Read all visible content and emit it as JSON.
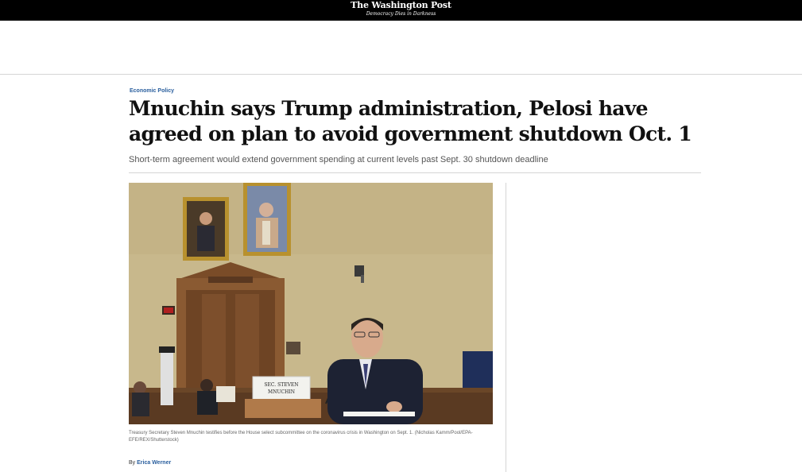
{
  "masthead": {
    "title": "The Washington Post",
    "tagline": "Democracy Dies in Darkness"
  },
  "article": {
    "section": "Economic Policy",
    "headline": "Mnuchin says Trump administration, Pelosi have agreed on plan to avoid government shutdown Oct. 1",
    "subheadline": "Short-term agreement would extend government spending at current levels past Sept. 30 shutdown deadline",
    "photo": {
      "nameplate_line1": "SEC. STEVEN",
      "nameplate_line2": "MNUCHIN"
    },
    "caption": "Treasury Secretary Steven Mnuchin testifies before the House select subcommittee on the coronavirus crisis in Washington on Sept. 1. (Nicholas Kamm/Pool/EPA-EFE/REX/Shutterstock)",
    "byline_prefix": "By",
    "author": "Erica Werner"
  },
  "colors": {
    "topbar": "#000000",
    "link": "#2a5f9e",
    "wall": "#c9b98e",
    "wood": "#8a5a32"
  }
}
